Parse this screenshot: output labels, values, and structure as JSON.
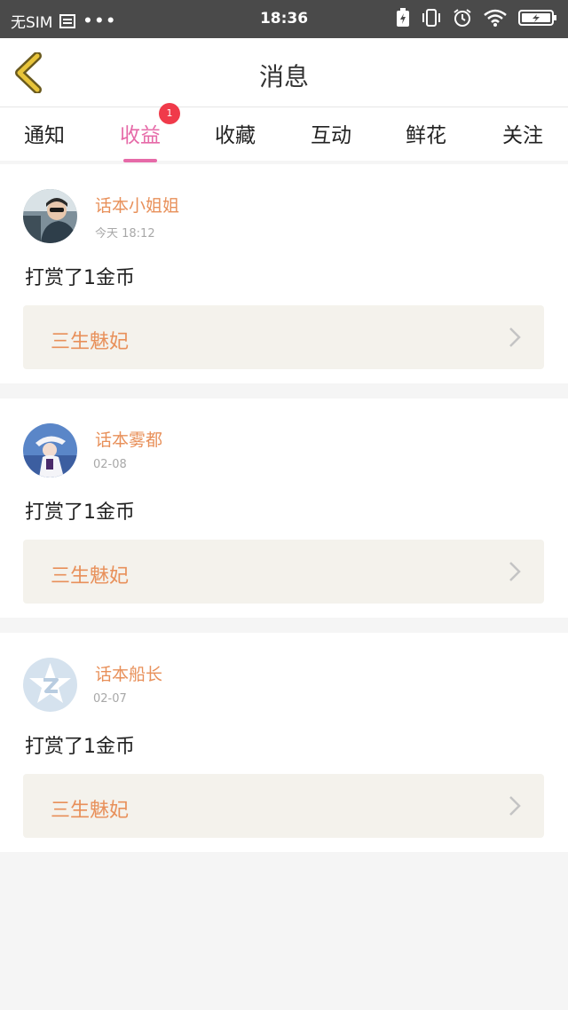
{
  "status_bar": {
    "carrier": "无SIM",
    "more": "•••",
    "time": "18:36"
  },
  "header": {
    "title": "消息",
    "accent_color": "#e8c43a"
  },
  "tabs": [
    {
      "label": "通知"
    },
    {
      "label": "收益",
      "active": true,
      "badge": "1"
    },
    {
      "label": "收藏"
    },
    {
      "label": "互动"
    },
    {
      "label": "鲜花"
    },
    {
      "label": "关注"
    }
  ],
  "colors": {
    "active_tab": "#e66aa8",
    "username": "#e8905a",
    "badge": "#f03a4a",
    "book_bar": "#f4f2ec"
  },
  "messages": [
    {
      "username": "话本小姐姐",
      "time": "今天 18:12",
      "text": "打赏了1金币",
      "book": "三生魅妃",
      "avatar": "photo-avatar"
    },
    {
      "username": "话本雾都",
      "time": "02-08",
      "text": "打赏了1金币",
      "book": "三生魅妃",
      "avatar": "photo-avatar"
    },
    {
      "username": "话本船长",
      "time": "02-07",
      "text": "打赏了1金币",
      "book": "三生魅妃",
      "avatar": "default-qq-avatar"
    }
  ]
}
